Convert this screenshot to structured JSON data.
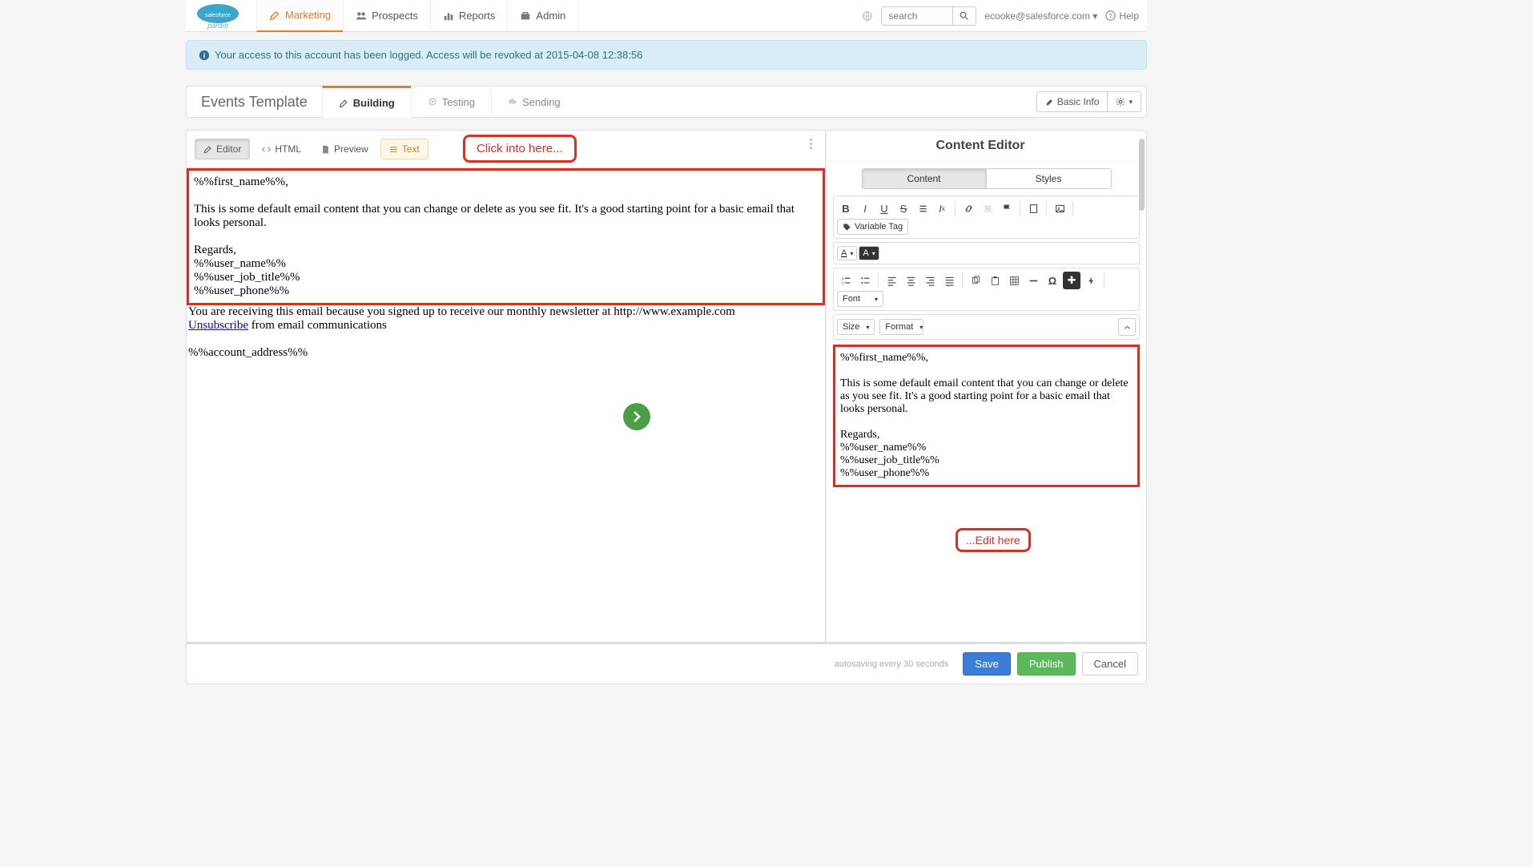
{
  "topnav": {
    "tabs": {
      "marketing": "Marketing",
      "prospects": "Prospects",
      "reports": "Reports",
      "admin": "Admin"
    },
    "search_placeholder": "search",
    "user_label": "ecooke@salesforce.com",
    "help_label": "Help"
  },
  "alert": {
    "text": "Your access to this account has been logged. Access will be revoked at 2015-04-08 12:38:56"
  },
  "page": {
    "title": "Events Template",
    "steps": {
      "building": "Building",
      "testing": "Testing",
      "sending": "Sending"
    },
    "basic_info": "Basic Info"
  },
  "view_tabs": {
    "editor": "Editor",
    "html": "HTML",
    "preview": "Preview",
    "text": "Text"
  },
  "callouts": {
    "click": "Click into here...",
    "edit": "...Edit here"
  },
  "email": {
    "greeting": "%%first_name%%,",
    "body": "This is some default email content that you can change or delete as you see fit. It's a good starting point for a basic email that looks personal.",
    "regards": "Regards,",
    "sig1": "%%user_name%%",
    "sig2": "%%user_job_title%%",
    "sig3": "%%user_phone%%",
    "footer1_pre": "You are receiving this email because you signed up to receive our monthly newsletter at http://www.example.com",
    "unsubscribe": "Unsubscribe",
    "footer1_post": " from email communications",
    "footer2": "%%account_address%%"
  },
  "right_panel": {
    "title": "Content Editor",
    "seg_content": "Content",
    "seg_styles": "Styles",
    "variable_tag": "Variable Tag",
    "size": "Size",
    "format": "Format",
    "font": "Font"
  },
  "footer": {
    "autosave": "autosaving every 30 seconds",
    "save": "Save",
    "publish": "Publish",
    "cancel": "Cancel"
  }
}
